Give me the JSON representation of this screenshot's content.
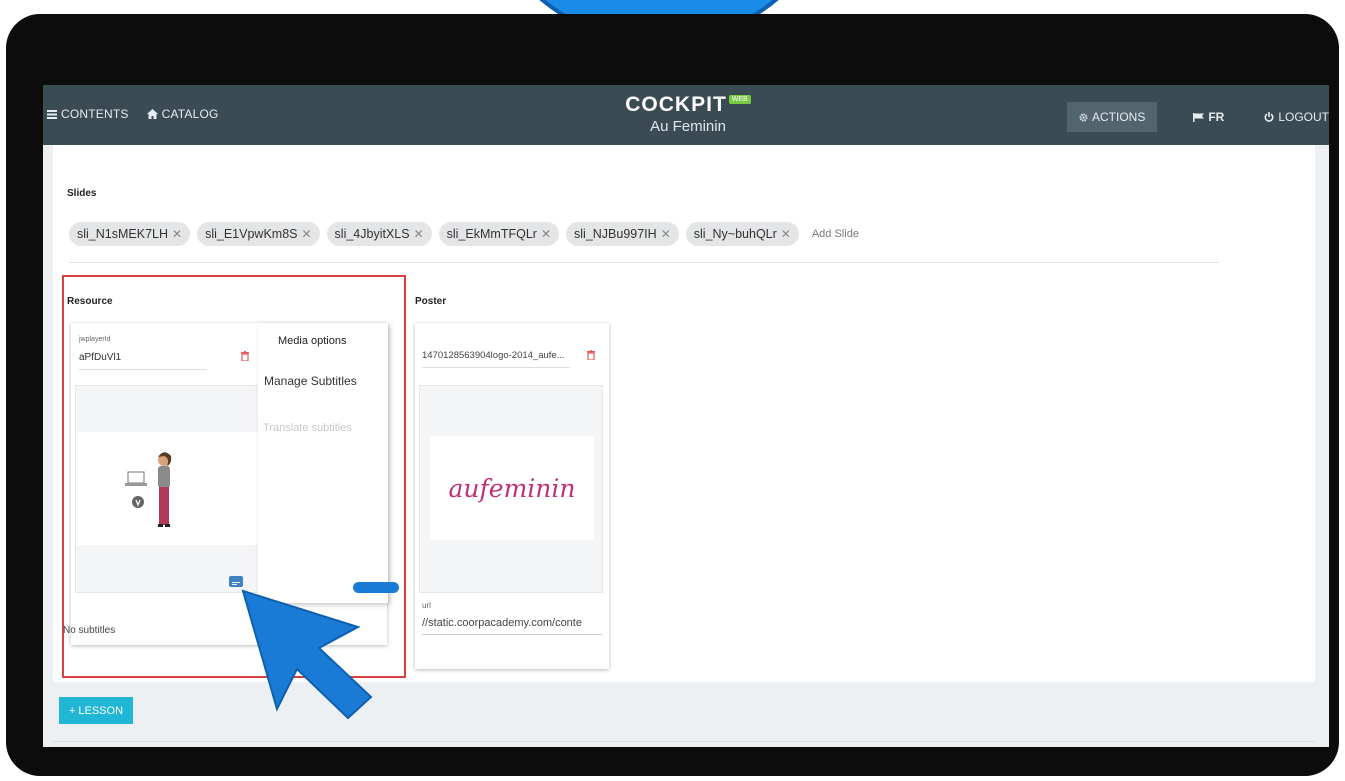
{
  "nav": {
    "contents": "CONTENTS",
    "catalog": "CATALOG",
    "brand_name": "COCKPIT",
    "brand_badge": "WEB",
    "brand_sub": "Au Feminin",
    "actions": "ACTIONS",
    "language": "FR",
    "logout": "LOGOUT"
  },
  "slides": {
    "label": "Slides",
    "chips": [
      "sli_N1sMEK7LH",
      "sli_E1VpwKm8S",
      "sli_4JbyitXLS",
      "sli_EkMmTFQLr",
      "sli_NJBu997IH",
      "sli_Ny~buhQLr"
    ],
    "add_placeholder": "Add Slide"
  },
  "resource": {
    "label": "Resource",
    "field_label": "jwplayerId",
    "field_value": "aPfDuVl1",
    "subtitles_status": "No subtitles"
  },
  "media_menu": {
    "title": "Media options",
    "manage": "Manage Subtitles",
    "translate": "Translate subtitles"
  },
  "poster": {
    "label": "Poster",
    "file": "1470128563904logo-2014_aufe...",
    "logo_text": "aufeminin",
    "url_label": "url",
    "url_value": "//static.coorpacademy.com/conte"
  },
  "lesson_button": "LESSON",
  "colors": {
    "topbar": "#3b4b54",
    "accent": "#21b5d6",
    "highlight": "#d64040",
    "pointer": "#1a7bd6"
  }
}
